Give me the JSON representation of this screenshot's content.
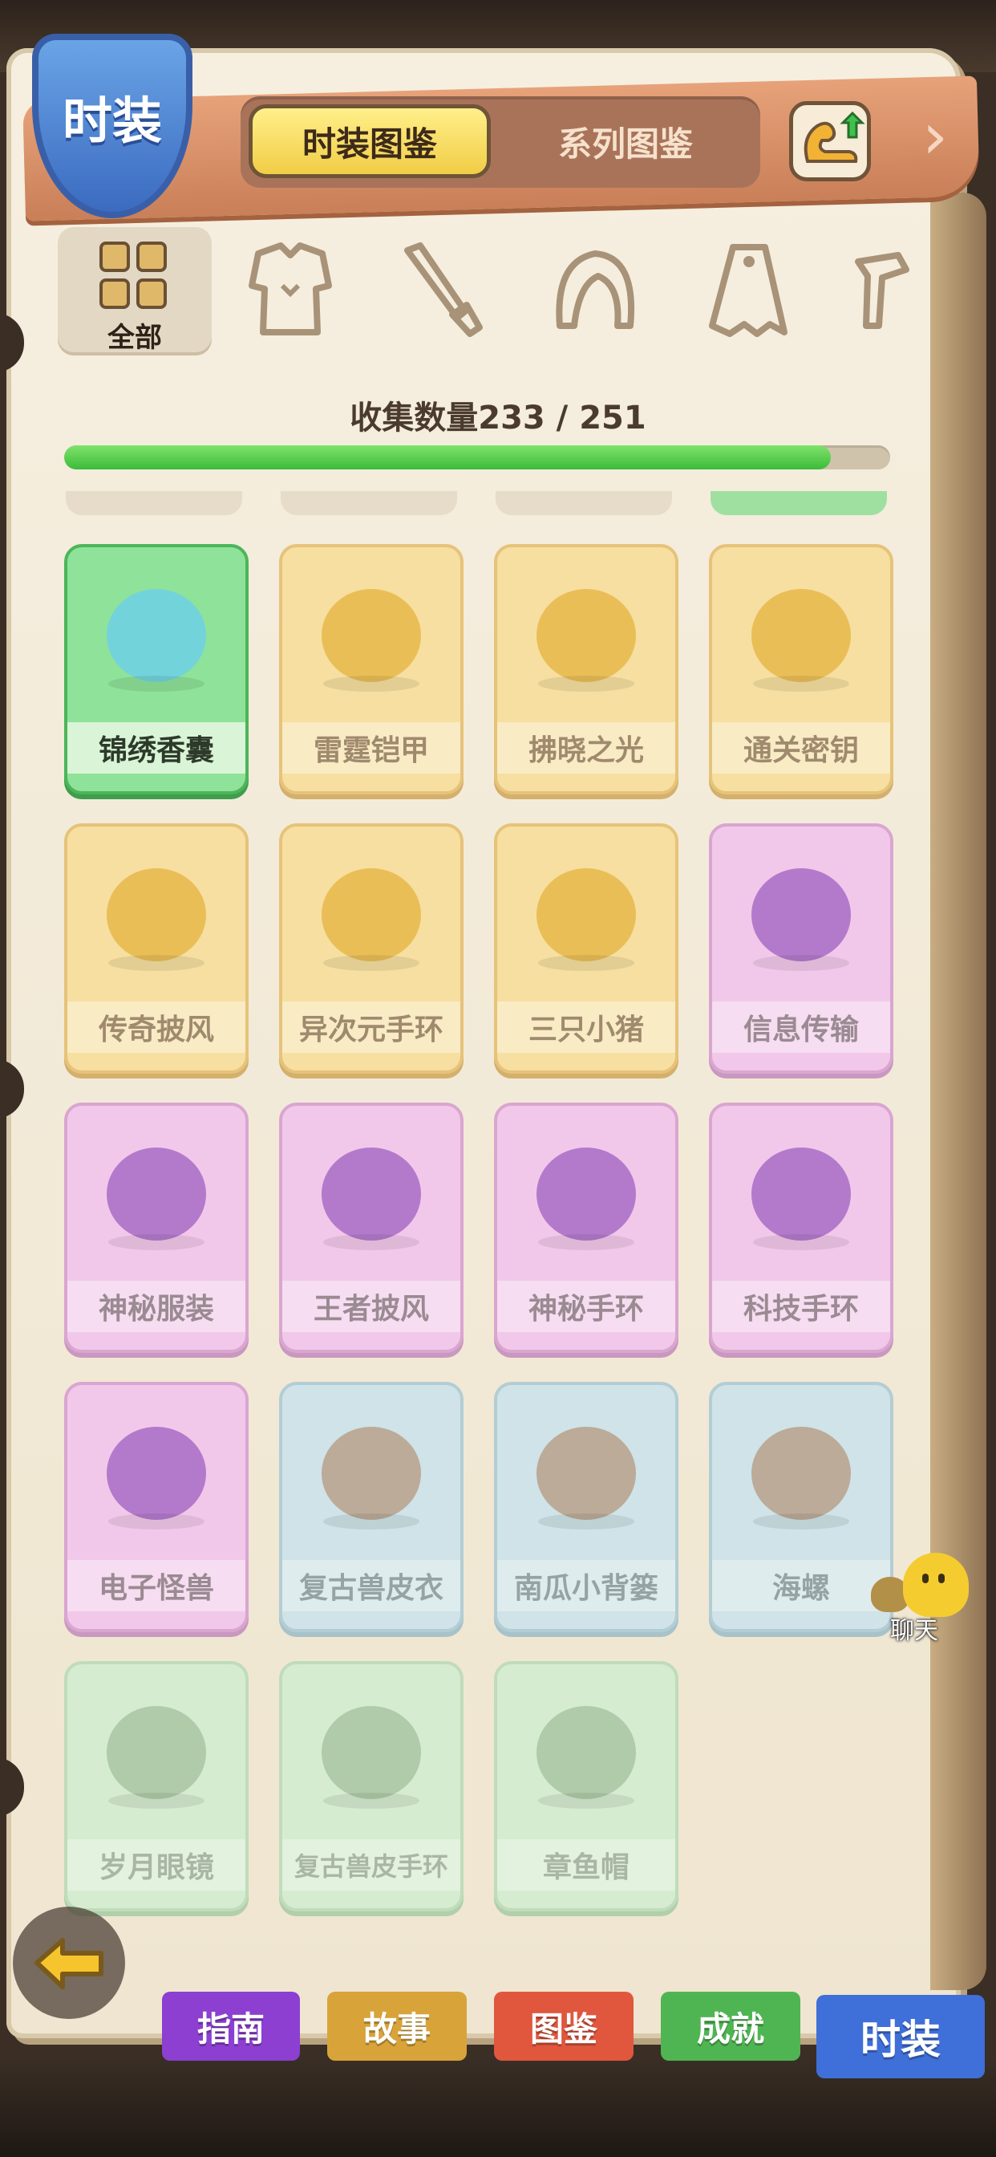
{
  "header": {
    "badge_label": "时装",
    "tabs": [
      {
        "label": "时装图鉴",
        "active": true
      },
      {
        "label": "系列图鉴",
        "active": false
      }
    ]
  },
  "categories": [
    {
      "label": "全部",
      "icon": "grid-icon",
      "active": true
    },
    {
      "icon": "armor-icon"
    },
    {
      "icon": "knife-icon"
    },
    {
      "icon": "hair-icon"
    },
    {
      "icon": "cape-icon"
    },
    {
      "icon": "accessory-icon"
    }
  ],
  "collection": {
    "label": "收集数量233 / 251",
    "collected": 233,
    "total": 251
  },
  "items": [
    {
      "name": "锦绣香囊",
      "rarity": "green"
    },
    {
      "name": "雷霆铠甲",
      "rarity": "gold"
    },
    {
      "name": "拂晓之光",
      "rarity": "gold"
    },
    {
      "name": "通关密钥",
      "rarity": "gold"
    },
    {
      "name": "传奇披风",
      "rarity": "gold"
    },
    {
      "name": "异次元手环",
      "rarity": "gold"
    },
    {
      "name": "三只小猪",
      "rarity": "gold"
    },
    {
      "name": "信息传输",
      "rarity": "pink"
    },
    {
      "name": "神秘服装",
      "rarity": "pink"
    },
    {
      "name": "王者披风",
      "rarity": "pink"
    },
    {
      "name": "神秘手环",
      "rarity": "pink"
    },
    {
      "name": "科技手环",
      "rarity": "pink"
    },
    {
      "name": "电子怪兽",
      "rarity": "pink"
    },
    {
      "name": "复古兽皮衣",
      "rarity": "blue"
    },
    {
      "name": "南瓜小背篓",
      "rarity": "blue"
    },
    {
      "name": "海螺",
      "rarity": "blue"
    },
    {
      "name": "岁月眼镜",
      "rarity": "lgreen"
    },
    {
      "name": "复古兽皮手环",
      "rarity": "lgreen"
    },
    {
      "name": "章鱼帽",
      "rarity": "lgreen"
    }
  ],
  "chat": {
    "label": "聊天"
  },
  "bottom_nav": [
    {
      "label": "指南",
      "color": "#8c3fd1"
    },
    {
      "label": "故事",
      "color": "#d8a43a"
    },
    {
      "label": "图鉴",
      "color": "#e0573e"
    },
    {
      "label": "成就",
      "color": "#4fb552"
    },
    {
      "label": "时装",
      "color": "#3f6fd8",
      "active": true
    }
  ]
}
